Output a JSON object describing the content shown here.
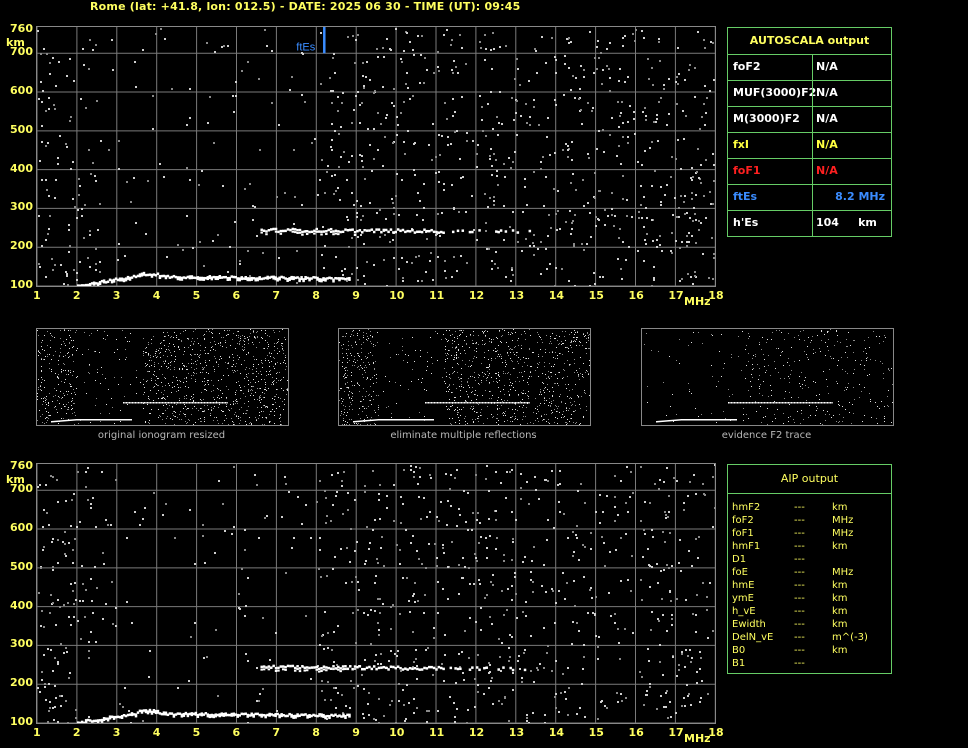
{
  "header": "Rome (lat: +41.8, lon: 012.5) - DATE: 2025 06 30 - TIME (UT): 09:45",
  "axes": {
    "y_ticks": [
      "760",
      "700",
      "600",
      "500",
      "400",
      "300",
      "200",
      "100"
    ],
    "y_unit": "km",
    "x_ticks": [
      "1",
      "2",
      "3",
      "4",
      "5",
      "6",
      "7",
      "8",
      "9",
      "10",
      "11",
      "12",
      "13",
      "14",
      "15",
      "16",
      "17",
      "18"
    ],
    "x_unit": "MHz"
  },
  "ftes_marker_label": "ftEs",
  "thumbnails": [
    {
      "caption": "original ionogram resized"
    },
    {
      "caption": "eliminate multiple reflections"
    },
    {
      "caption": "evidence F2 trace"
    }
  ],
  "autoscala": {
    "title": "AUTOSCALA output",
    "rows": [
      {
        "key": "foF2",
        "value": "N/A",
        "color": "#ffffff"
      },
      {
        "key": "MUF(3000)F2",
        "value": "N/A",
        "color": "#ffffff"
      },
      {
        "key": "M(3000)F2",
        "value": "N/A",
        "color": "#ffffff"
      },
      {
        "key": "fxI",
        "value": "N/A",
        "color": "#ffff40"
      },
      {
        "key": "foF1",
        "value": "N/A",
        "color": "#ff2020"
      },
      {
        "key": "ftEs",
        "value": "8.2 MHz",
        "color": "#3a8cff"
      },
      {
        "key": "h'Es",
        "value": "104     km",
        "color": "#ffffff"
      }
    ]
  },
  "aip": {
    "title": "AIP output",
    "rows": [
      {
        "key": "hmF2",
        "value": "---",
        "unit": "km"
      },
      {
        "key": "foF2",
        "value": "---",
        "unit": "MHz"
      },
      {
        "key": "foF1",
        "value": "---",
        "unit": "MHz"
      },
      {
        "key": "hmF1",
        "value": "---",
        "unit": "km"
      },
      {
        "key": "D1",
        "value": "---",
        "unit": ""
      },
      {
        "key": "foE",
        "value": "---",
        "unit": "MHz"
      },
      {
        "key": "hmE",
        "value": "---",
        "unit": "km"
      },
      {
        "key": "ymE",
        "value": "---",
        "unit": "km"
      },
      {
        "key": "h_vE",
        "value": "---",
        "unit": "km"
      },
      {
        "key": "Ewidth",
        "value": "---",
        "unit": "km"
      },
      {
        "key": "DelN_vE",
        "value": "---",
        "unit": "m^(-3)"
      },
      {
        "key": "B0",
        "value": "---",
        "unit": "km"
      },
      {
        "key": "B1",
        "value": "---",
        "unit": ""
      }
    ]
  },
  "colors": {
    "grid": "#7a7a7a",
    "label": "#ffff60",
    "accent": "#3a8cff",
    "panel_border": "#66cc66"
  }
}
